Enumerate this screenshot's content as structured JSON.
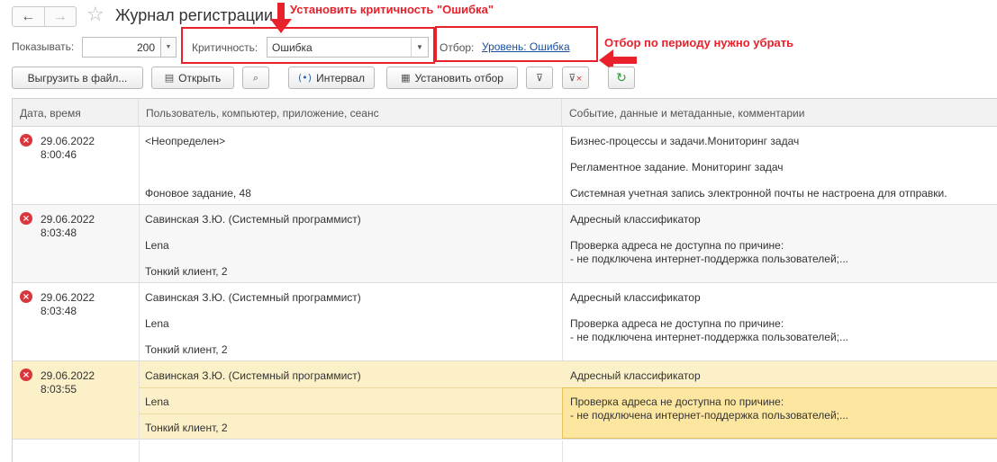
{
  "window": {
    "title": "Журнал регистрации",
    "back_icon": "←",
    "forward_icon": "→",
    "star_icon": "☆"
  },
  "filters": {
    "show_label": "Показывать:",
    "show_count": "200",
    "criticality_label": "Критичность:",
    "criticality_value": "Ошибка",
    "filter_label": "Отбор:",
    "filter_link": "Уровень: Ошибка"
  },
  "annotations": {
    "set_criticality": "Установить критичность \"Ошибка\"",
    "remove_period": "Отбор по периоду нужно убрать",
    "color": "#e8212b"
  },
  "toolbar": {
    "export": "Выгрузить в файл...",
    "open": "Открыть",
    "interval": "Интервал",
    "set_filter": "Установить отбор"
  },
  "table": {
    "columns": [
      "Дата, время",
      "Пользователь, компьютер, приложение, сеанс",
      "Событие, данные и метаданные, комментарии"
    ],
    "rows": [
      {
        "date": "29.06.2022",
        "time": "8:00:46",
        "user": [
          "<Неопределен>",
          "",
          "Фоновое задание, 48"
        ],
        "event": [
          "Бизнес-процессы и задачи.Мониторинг задач",
          "Регламентное задание. Мониторинг задач",
          "Системная учетная запись электронной почты не настроена для отправки."
        ]
      },
      {
        "date": "29.06.2022",
        "time": "8:03:48",
        "user": [
          "Савинская З.Ю. (Системный программист)",
          "Lena",
          "Тонкий клиент, 2"
        ],
        "event": [
          "Адресный классификатор",
          "Проверка адреса не доступна по причине:",
          "- не подключена интернет-поддержка пользователей;..."
        ]
      },
      {
        "date": "29.06.2022",
        "time": "8:03:48",
        "user": [
          "Савинская З.Ю. (Системный программист)",
          "Lena",
          "Тонкий клиент, 2"
        ],
        "event": [
          "Адресный классификатор",
          "Проверка адреса не доступна по причине:",
          "- не подключена интернет-поддержка пользователей;..."
        ]
      },
      {
        "date": "29.06.2022",
        "time": "8:03:55",
        "user": [
          "Савинская З.Ю. (Системный программист)",
          "Lena",
          "Тонкий клиент, 2"
        ],
        "event": [
          "Адресный классификатор",
          "Проверка адреса не доступна по причине:",
          "- не подключена интернет-поддержка пользователей;..."
        ]
      }
    ]
  }
}
